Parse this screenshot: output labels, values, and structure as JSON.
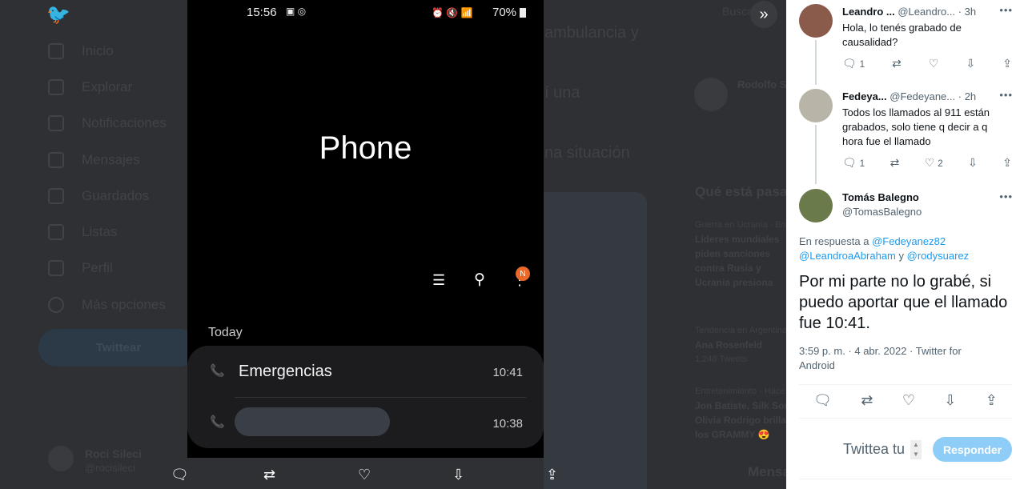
{
  "background": {
    "nav": [
      "Inicio",
      "Explorar",
      "Notificaciones",
      "Mensajes",
      "Guardados",
      "Listas",
      "Perfil",
      "Más opciones"
    ],
    "tweet_button": "Twittear",
    "user_name": "Roci Sileci",
    "user_handle": "@rocisileci",
    "tweet_fragments": [
      "ambulancia y",
      "í una",
      "na situación"
    ],
    "search": "Buscar",
    "suggested_name": "Rodolfo S",
    "trends_title": "Qué está pasando",
    "trends": [
      {
        "context": "Guerra en Ucrania · En vivo",
        "title": "Líderes mundiales piden sanciones contra Rusia y Ucrania presiona para que investiguen crímenes"
      },
      {
        "context": "Tendencia en Argentina",
        "title": "Ana Rosenfeld",
        "count": "1.248 Tweets"
      },
      {
        "context": "Entretenimiento · Hace",
        "title": "Jon Batiste, Silk Sonic y Olivia Rodrigo brillan en los GRAMMY 😍"
      }
    ],
    "messages": "Mensajes"
  },
  "phone": {
    "time": "15:56",
    "battery": "70%",
    "title": "Phone",
    "section": "Today",
    "badge": "N",
    "calls": [
      {
        "name": "Emergencias",
        "time": "10:41"
      },
      {
        "name": "",
        "time": "10:38"
      }
    ]
  },
  "media_actions": [
    "comment",
    "retweet",
    "like",
    "download",
    "share"
  ],
  "panel": {
    "replies": [
      {
        "name": "Leandro ...",
        "handle": "@Leandro...",
        "time": "· 3h",
        "text": "Hola, lo tenés grabado de causalidad?",
        "replies": "1",
        "likes": ""
      },
      {
        "name": "Fedeya...",
        "handle": "@Fedeyane...",
        "time": "· 2h",
        "text": "Todos los llamados al 911 están grabados, solo tiene q decir a q hora fue el llamado",
        "replies": "1",
        "likes": "2"
      }
    ],
    "main": {
      "name": "Tomás Balegno",
      "handle": "@TomasBalegno",
      "reply_prefix": "En respuesta a",
      "mention1": "@Fedeyanez82",
      "mention2": "@LeandroaAbraham",
      "and": "y",
      "mention3": "@rodysuarez",
      "text": "Por mi parte no lo grabé, si puedo aportar que el llamado fue 10:41.",
      "meta": "3:59 p. m. · 4 abr. 2022 · Twitter for Android"
    },
    "compose_placeholder": "Twittea tu",
    "reply_button": "Responder"
  }
}
